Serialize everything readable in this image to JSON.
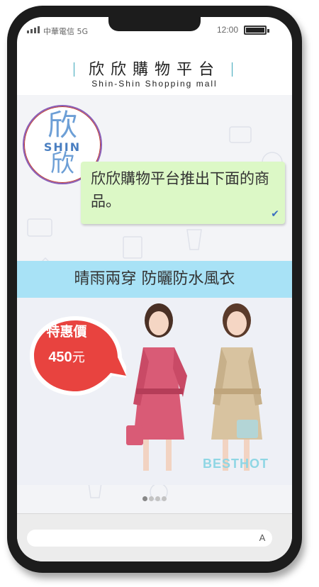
{
  "status": {
    "carrier": "中華電信 5G",
    "time": "12:00"
  },
  "brand": {
    "title": "欣欣購物平台",
    "subtitle": "Shin-Shin Shopping mall",
    "accent": "#3aa6b9"
  },
  "avatar": {
    "top_glyph": "欣",
    "latin": "SHIN",
    "bottom_glyph": "欣"
  },
  "message": {
    "text": "欣欣購物平台推出下面的商品。",
    "status_icon": "check-icon",
    "bubble_color": "#dcf8c6"
  },
  "banner": {
    "text": "晴雨兩穿 防曬防水風衣",
    "color": "#a8e2f6"
  },
  "product": {
    "tag_label": "特惠價",
    "price": "450",
    "currency": "元",
    "tag_color": "#e8433f",
    "watermark": "BESTHOT"
  },
  "carousel": {
    "count": 4,
    "active": 0
  },
  "composer": {
    "value": "",
    "keyboard_label": "A"
  }
}
